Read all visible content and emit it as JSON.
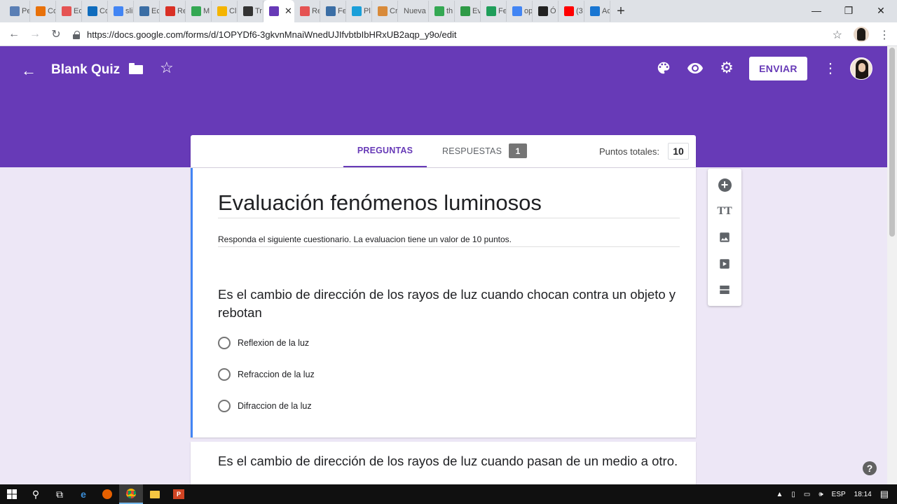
{
  "browser": {
    "tabs": [
      {
        "label": "Pe",
        "color": "#5a7fb5"
      },
      {
        "label": "Co",
        "color": "#e8710a"
      },
      {
        "label": "Ec",
        "color": "#e55353"
      },
      {
        "label": "Co",
        "color": "#0f6cbd"
      },
      {
        "label": "sli",
        "color": "#4285f4"
      },
      {
        "label": "Ec",
        "color": "#3b6ea5"
      },
      {
        "label": "Re",
        "color": "#d93025"
      },
      {
        "label": "M",
        "color": "#34a853"
      },
      {
        "label": "Cl",
        "color": "#f4b400"
      },
      {
        "label": "Tr",
        "color": "#333333"
      },
      {
        "label": "",
        "color": "#673ab7",
        "active": true
      },
      {
        "label": "Re",
        "color": "#e55353"
      },
      {
        "label": "Fe",
        "color": "#3b6ea5"
      },
      {
        "label": "Pl",
        "color": "#1a9fd9"
      },
      {
        "label": "Cr",
        "color": "#d88a3a"
      },
      {
        "label": "Nueva",
        "color": ""
      },
      {
        "label": "th",
        "color": "#34a853"
      },
      {
        "label": "Ev",
        "color": "#2e9a46"
      },
      {
        "label": "Fe",
        "color": "#1f9e5a"
      },
      {
        "label": "op",
        "color": "#4285f4"
      },
      {
        "label": "Ó",
        "color": "#222222"
      },
      {
        "label": "(3",
        "color": "#ff0000"
      },
      {
        "label": "Ac",
        "color": "#1976d2"
      }
    ],
    "url": "https://docs.google.com/forms/d/1OPYDf6-3gkvnMnaiWnedUJIfvbtbIbHRxUB2aqp_y9o/edit"
  },
  "header": {
    "title": "Blank Quiz",
    "send_label": "ENVIAR",
    "accent": "#673ab7"
  },
  "tabs": {
    "questions_label": "PREGUNTAS",
    "responses_label": "RESPUESTAS",
    "responses_count": "1",
    "points_label": "Puntos totales:",
    "points_value": "10"
  },
  "form": {
    "title": "Evaluación fenómenos luminosos",
    "description": "Responda el siguiente cuestionario. La evaluacion tiene un valor de 10 puntos."
  },
  "questions": [
    {
      "text": "Es el cambio de dirección de los rayos de luz cuando chocan contra un objeto y rebotan",
      "options": [
        "Reflexion de la luz",
        "Refraccion de la luz",
        "Difraccion de la luz"
      ]
    },
    {
      "text": "Es el cambio de dirección de los rayos de luz cuando pasan de un medio a otro."
    }
  ],
  "taskbar": {
    "language": "ESP",
    "time": "18:14"
  }
}
